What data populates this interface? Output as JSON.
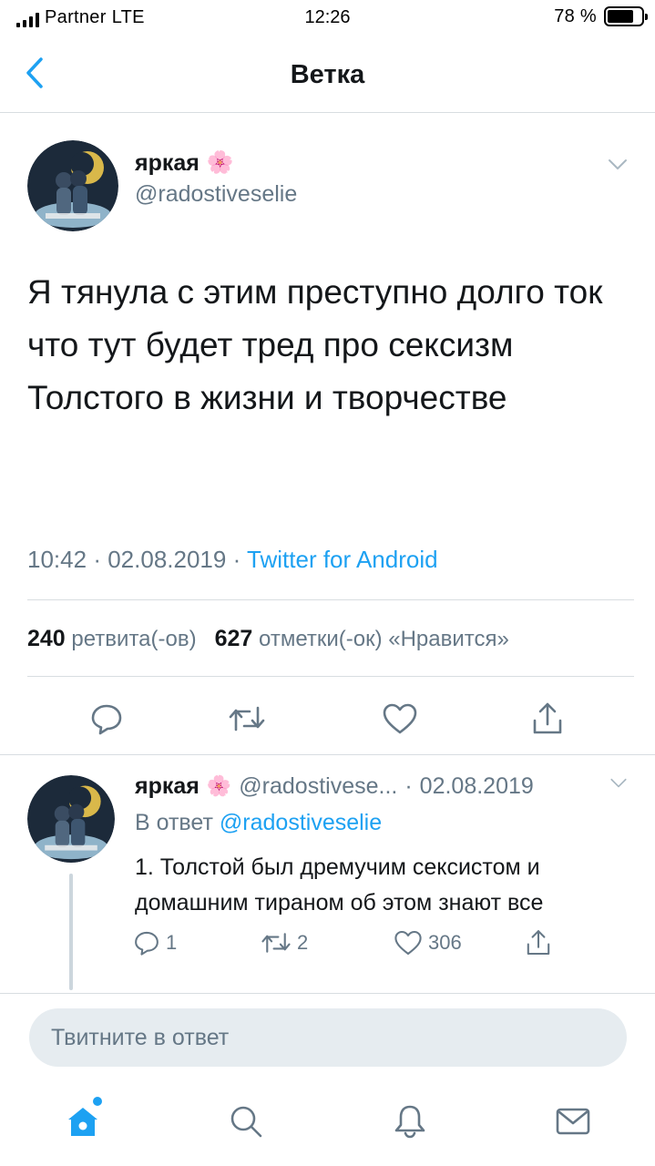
{
  "status_bar": {
    "carrier": "Partner",
    "network": "LTE",
    "time": "12:26",
    "battery_text": "78 %",
    "battery_level": 0.78
  },
  "nav": {
    "title": "Ветка",
    "back_icon": "chevron-left-icon"
  },
  "main_tweet": {
    "author_name": "яркая",
    "author_emoji": "🌸",
    "handle": "@radostiveselie",
    "text": "Я тянула с этим преступно долго ток что тут будет тред про сексизм Толстого в жизни и творчестве",
    "time": "10:42",
    "date": "02.08.2019",
    "separator": "·",
    "source": "Twitter for Android",
    "retweets_count": "240",
    "retweets_label": "ретвита(-ов)",
    "likes_count": "627",
    "likes_label": "отметки(-ок) «Нравится»"
  },
  "reply_tweet": {
    "author_name": "яркая",
    "author_emoji": "🌸",
    "handle": "@radostivese...",
    "separator": "·",
    "date": "02.08.2019",
    "reply_to_label": "В ответ",
    "reply_to_handle": "@radostiveselie",
    "text": "1. Толстой был дремучим сексистом и домашним тираном об этом знают все",
    "reply_count": "1",
    "retweet_count": "2",
    "like_count": "306"
  },
  "composer": {
    "placeholder": "Твитните в ответ"
  },
  "tabs": [
    "home-icon",
    "search-icon",
    "bell-icon",
    "mail-icon"
  ],
  "colors": {
    "accent": "#1da1f2",
    "secondary_text": "#657786",
    "divider": "#d8dde1"
  }
}
